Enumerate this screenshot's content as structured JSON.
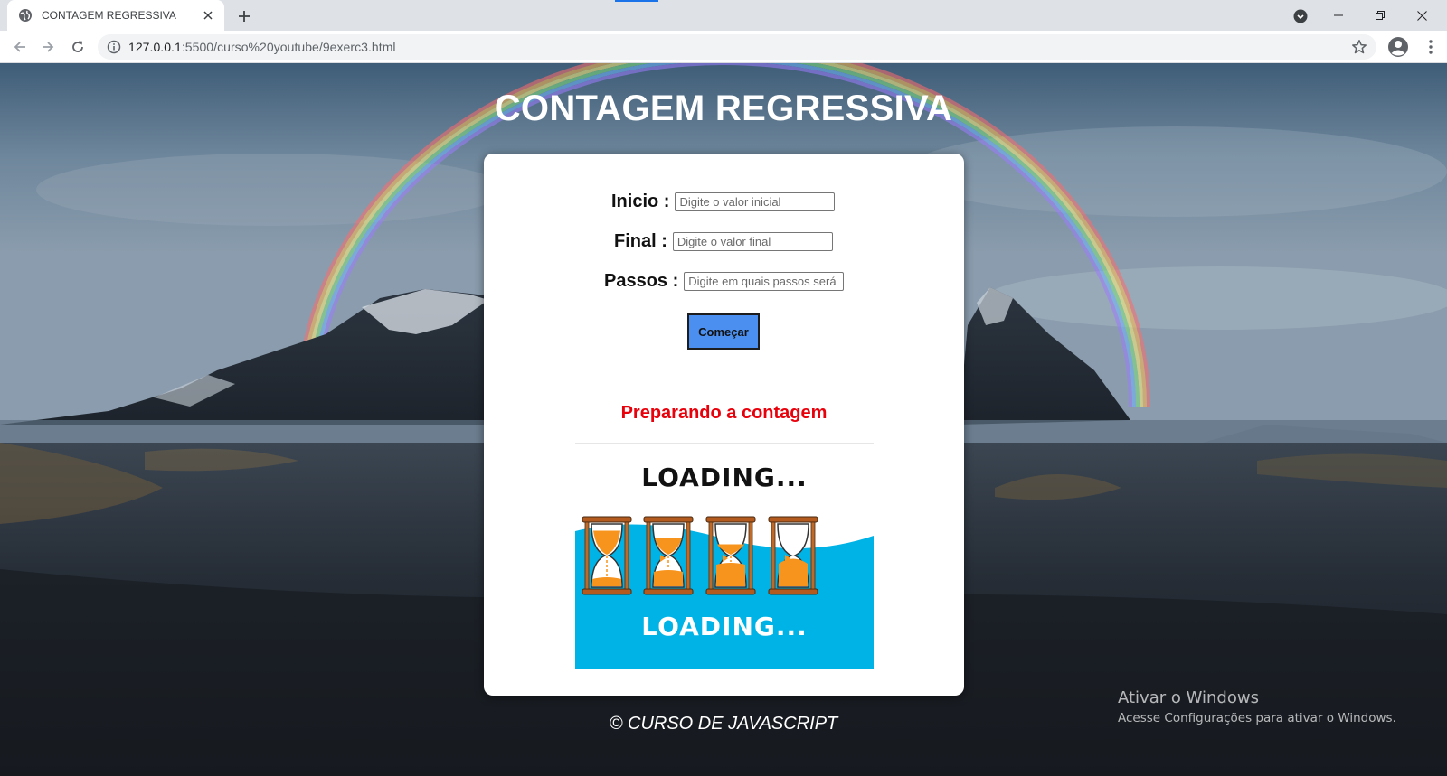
{
  "browser": {
    "tab_title": "CONTAGEM REGRESSIVA",
    "url_host": "127.0.0.1",
    "url_path": ":5500/curso%20youtube/9exerc3.html",
    "icons": [
      "globe-icon",
      "close-icon",
      "plus-icon",
      "back-icon",
      "forward-icon",
      "reload-icon",
      "info-icon",
      "star-icon",
      "profile-icon",
      "kebab-icon",
      "minimize-icon",
      "restore-icon",
      "window-close-icon",
      "tab-search-icon"
    ]
  },
  "page": {
    "title": "CONTAGEM REGRESSIVA",
    "form": {
      "inicio_label": "Inicio :",
      "inicio_placeholder": "Digite o valor inicial",
      "final_label": "Final :",
      "final_placeholder": "Digite o valor final",
      "passos_label": "Passos :",
      "passos_placeholder": "Digite em quais passos será",
      "start_button": "Começar"
    },
    "status_text": "Preparando a contagem",
    "status_color": "#e8000b",
    "loading_image": {
      "top_text": "LOADING...",
      "bottom_text": "LOADING...",
      "wave_color": "#00b3e6",
      "sand_color": "#f7941d",
      "hourglass_fill_levels": [
        0.25,
        0.5,
        0.75,
        1.0
      ]
    },
    "footer": "© CURSO DE JAVASCRIPT"
  },
  "os_watermark": {
    "title": "Ativar o Windows",
    "subtitle": "Acesse Configurações para ativar o Windows."
  }
}
